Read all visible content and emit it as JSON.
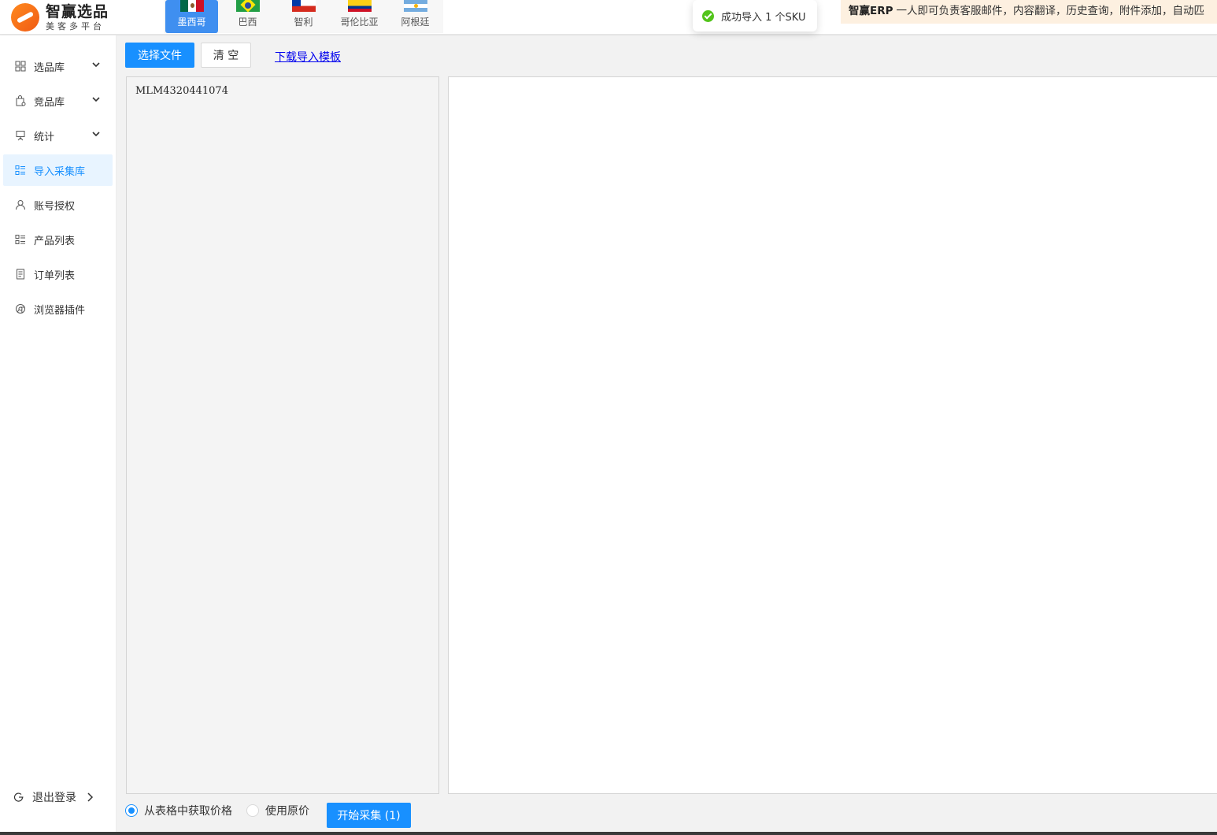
{
  "brand": {
    "title": "智赢选品",
    "subtitle": "美客多平台"
  },
  "countries": [
    {
      "label": "墨西哥",
      "flag": "mx",
      "active": true
    },
    {
      "label": "巴西",
      "flag": "br",
      "active": false
    },
    {
      "label": "智利",
      "flag": "cl",
      "active": false
    },
    {
      "label": "哥伦比亚",
      "flag": "co",
      "active": false
    },
    {
      "label": "阿根廷",
      "flag": "ar",
      "active": false
    }
  ],
  "toast": {
    "message": "成功导入 1 个SKU",
    "icon": "check-circle-icon",
    "color": "#52c41a"
  },
  "notice": {
    "brand": "智赢ERP",
    "text": "一人即可负责客服邮件，内容翻译，历史查询，附件添加，自动匹"
  },
  "sidebar": {
    "items": [
      {
        "label": "选品库",
        "icon": "grid-icon",
        "expandable": true
      },
      {
        "label": "竞品库",
        "icon": "shopping-bag-icon",
        "expandable": true
      },
      {
        "label": "统计",
        "icon": "presentation-icon",
        "expandable": true
      },
      {
        "label": "导入采集库",
        "icon": "list-icon",
        "expandable": false,
        "active": true
      },
      {
        "label": "账号授权",
        "icon": "user-icon",
        "expandable": false
      },
      {
        "label": "产品列表",
        "icon": "list-icon",
        "expandable": false
      },
      {
        "label": "订单列表",
        "icon": "document-icon",
        "expandable": false
      },
      {
        "label": "浏览器插件",
        "icon": "chrome-icon",
        "expandable": false
      }
    ],
    "logout": "退出登录"
  },
  "toolbar": {
    "choose_file": "选择文件",
    "clear": "清 空",
    "download_template": "下载导入模板"
  },
  "editor": {
    "content": "MLM4320441074"
  },
  "footer": {
    "price_options": [
      {
        "label": "从表格中获取价格",
        "checked": true
      },
      {
        "label": "使用原价",
        "checked": false
      }
    ],
    "start_button": "开始采集 (1)"
  },
  "colors": {
    "primary": "#1890ff",
    "active_tab": "#3f8ff0",
    "notice_bg": "#fdf0e0",
    "success": "#52c41a"
  }
}
